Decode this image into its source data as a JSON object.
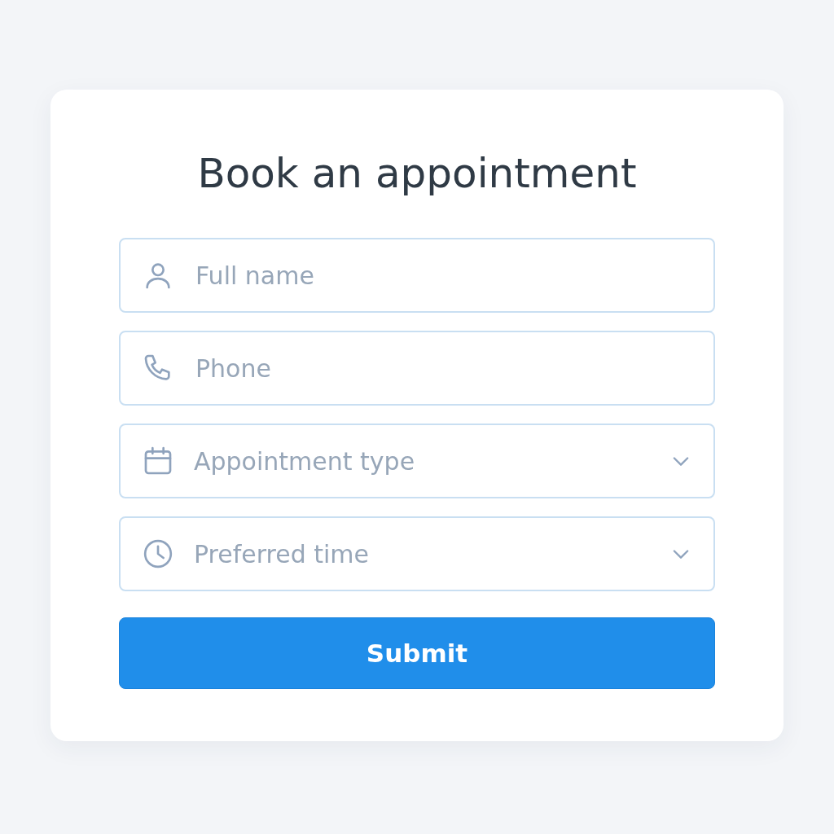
{
  "title": "Book an appointment",
  "fields": [
    {
      "kind": "text",
      "placeholder": "Full name"
    },
    {
      "kind": "text",
      "placeholder": "Phone"
    },
    {
      "kind": "select",
      "placeholder": "Appointment type"
    },
    {
      "kind": "select",
      "placeholder": "Preferred time"
    }
  ],
  "submit": {
    "label": "Submit"
  }
}
